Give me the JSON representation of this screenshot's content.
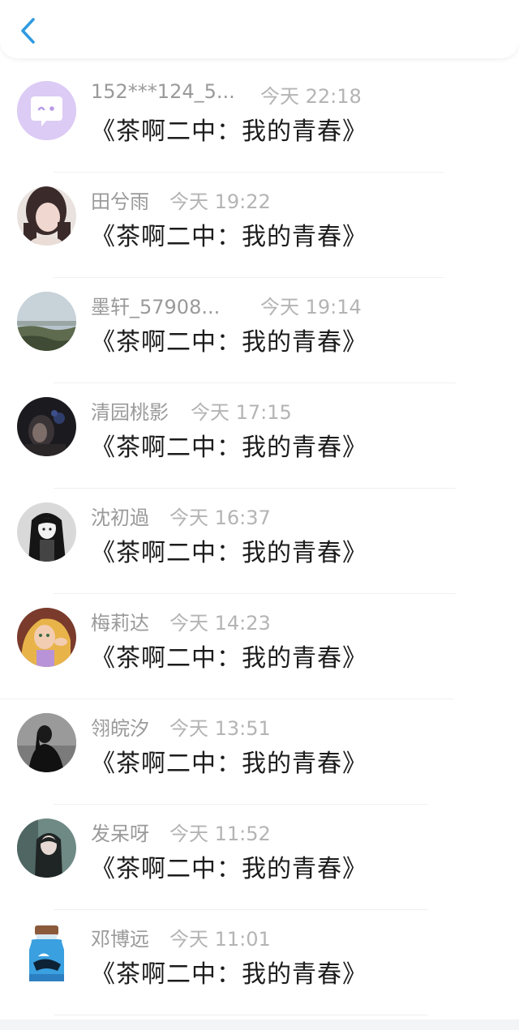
{
  "header": {
    "back_icon": "chevron-left-icon",
    "accent_color": "#2f9ae0"
  },
  "list": {
    "items": [
      {
        "name": "152***124_5...",
        "time": "今天 22:18",
        "message": "《茶啊二中：我的青春》",
        "avatar": "chat-bubble-face"
      },
      {
        "name": "田兮雨",
        "time": "今天 19:22",
        "message": "《茶啊二中：我的青春》",
        "avatar": "photo-girl"
      },
      {
        "name": "墨轩_57908...",
        "time": "今天 19:14",
        "message": "《茶啊二中：我的青春》",
        "avatar": "photo-landscape"
      },
      {
        "name": "清园桃影",
        "time": "今天 17:15",
        "message": "《茶啊二中：我的青春》",
        "avatar": "photo-dark"
      },
      {
        "name": "沈初過",
        "time": "今天 16:37",
        "message": "《茶啊二中：我的青春》",
        "avatar": "anime-dark-hair"
      },
      {
        "name": "梅莉达",
        "time": "今天 14:23",
        "message": "《茶啊二中：我的青春》",
        "avatar": "cartoon-princess"
      },
      {
        "name": "翎皖汐",
        "time": "今天 13:51",
        "message": "《茶啊二中：我的青春》",
        "avatar": "photo-silhouette"
      },
      {
        "name": "发呆呀",
        "time": "今天 11:52",
        "message": "《茶啊二中：我的青春》",
        "avatar": "photo-portrait"
      },
      {
        "name": "邓博远",
        "time": "今天 11:01",
        "message": "《茶啊二中：我的青春》",
        "avatar": "bottle-ocean"
      }
    ]
  }
}
